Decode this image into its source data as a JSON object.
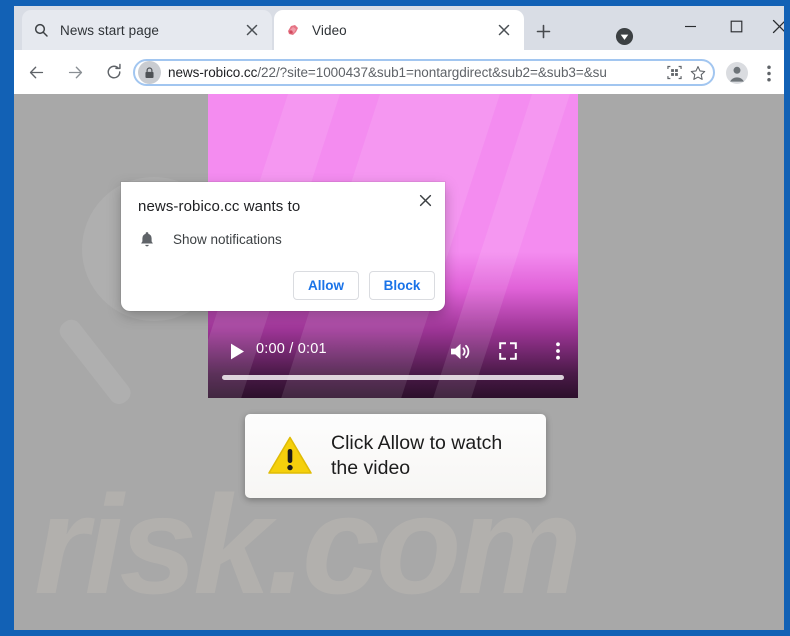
{
  "window": {
    "frame_color": "#1261b5",
    "controls": {
      "download_indicator": "download-indicator",
      "minimize": "—",
      "maximize": "☐",
      "close": "✕"
    }
  },
  "tabs": [
    {
      "title": "News start page",
      "favicon": "search-icon",
      "active": false,
      "close_label": "✕"
    },
    {
      "title": "Video",
      "favicon": "video-site-favicon",
      "active": true,
      "close_label": "✕"
    }
  ],
  "new_tab_label": "+",
  "toolbar": {
    "back_label": "←",
    "forward_label": "→",
    "reload_label": "⟳",
    "omnibox": {
      "lock_icon": "lock-icon",
      "host": "news-robico.cc",
      "path": "/22/?site=1000437&sub1=nontargdirect&sub2=&sub3=&su",
      "full_url": "news-robico.cc/22/?site=1000437&sub1=nontargdirect&sub2=&sub3=&su",
      "qr_icon": "qr-code-icon",
      "bookmark_icon": "star-icon"
    },
    "profile_icon": "profile-avatar-icon",
    "menu_icon": "three-dot-menu-icon"
  },
  "page": {
    "background_color": "#a8a8a8",
    "watermark_text": "risk.com",
    "video_player": {
      "accent_color": "#f48cf0",
      "play_label": "▶",
      "time_display": "0:00 / 0:01",
      "current_time": "0:00",
      "duration": "0:01",
      "volume_icon": "volume-icon",
      "fullscreen_icon": "fullscreen-icon",
      "more_icon": "video-more-options-icon",
      "progress_percent": 0
    },
    "allow_banner": {
      "icon": "warning-triangle-icon",
      "text": "Click Allow to watch the video"
    }
  },
  "notification_popup": {
    "title": "news-robico.cc wants to",
    "permission_icon": "bell-icon",
    "permission_label": "Show notifications",
    "close_label": "✕",
    "allow_label": "Allow",
    "block_label": "Block",
    "link_color": "#1a73e8"
  }
}
